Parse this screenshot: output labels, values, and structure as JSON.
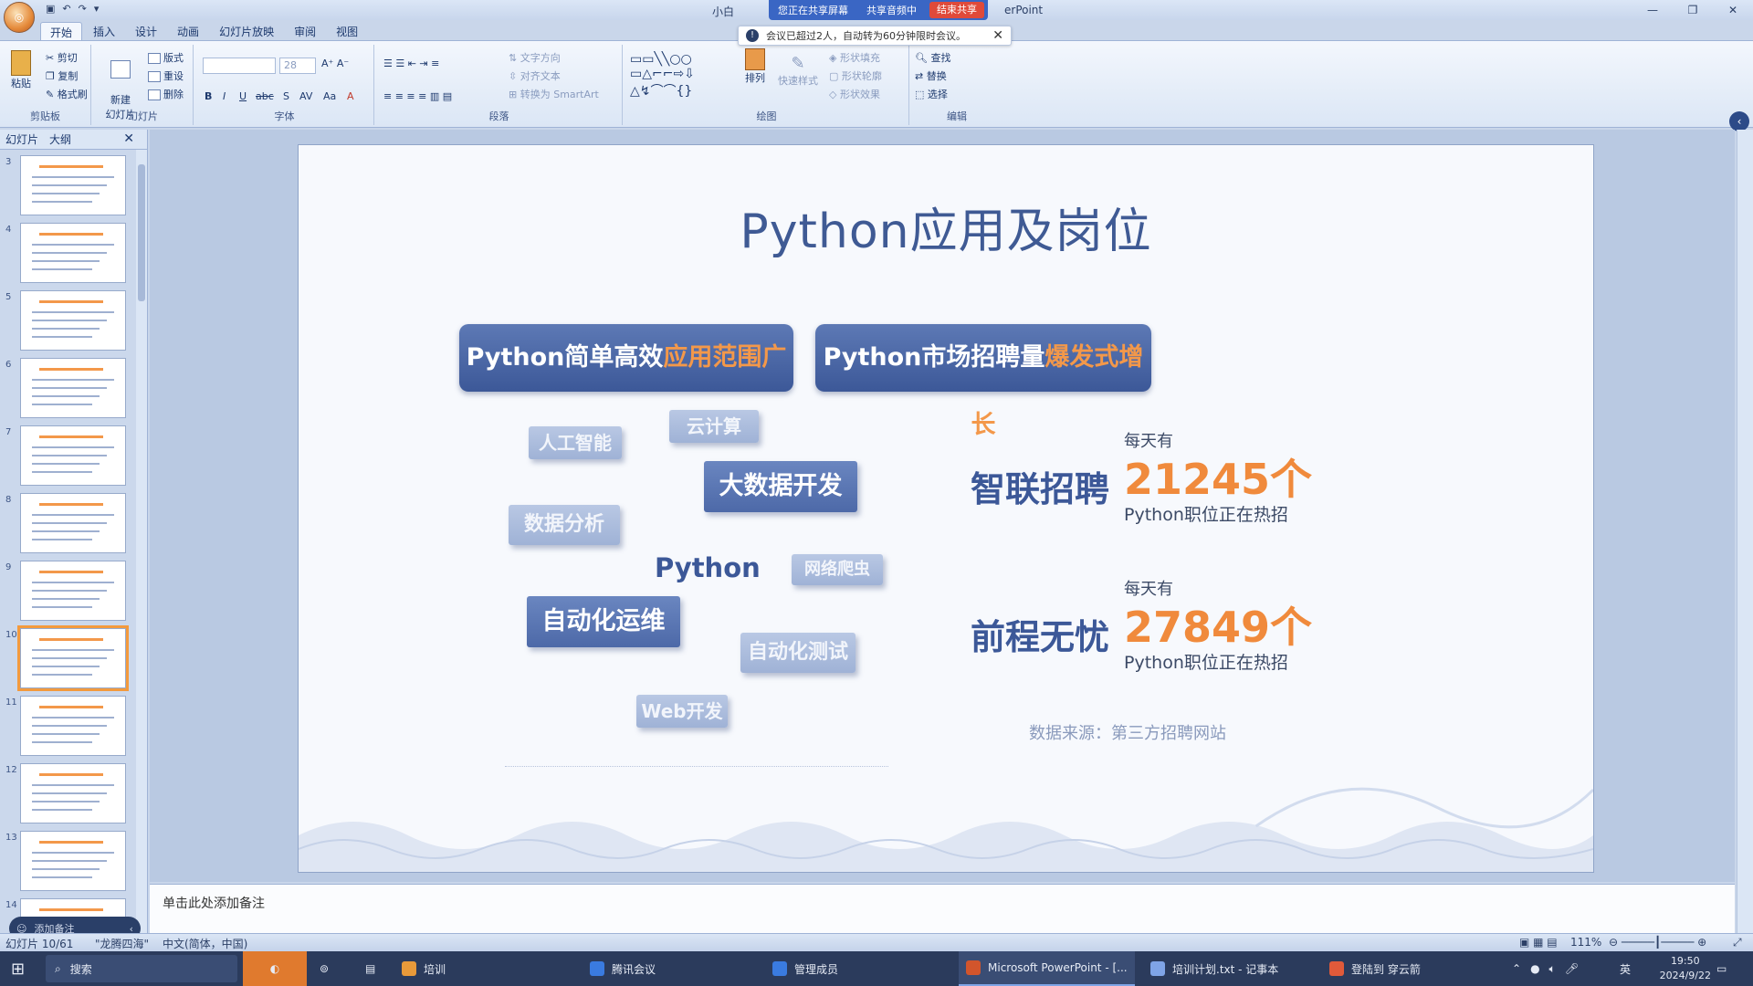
{
  "window": {
    "title_left": "小白",
    "title_right": "erPoint",
    "share": {
      "status": "您正在共享屏幕",
      "audio": "共享音频中",
      "end": "结束共享"
    },
    "controls": [
      "—",
      "❐",
      "✕"
    ]
  },
  "notice": {
    "text": "会议已超过2人，自动转为60分钟限时会议。"
  },
  "ribbon": {
    "tabs": [
      "开始",
      "插入",
      "设计",
      "动画",
      "幻灯片放映",
      "审阅",
      "视图"
    ],
    "active_tab": "开始",
    "groups": {
      "clipboard": {
        "label": "剪贴板",
        "paste": "粘贴",
        "cut": "剪切",
        "copy": "复制",
        "format_painter": "格式刷"
      },
      "slides": {
        "label": "幻灯片",
        "new_slide": "新建\n幻灯片",
        "layout": "版式",
        "reset": "重设",
        "delete": "删除"
      },
      "font": {
        "label": "字体",
        "size": "28",
        "buttons": [
          "B",
          "I",
          "U",
          "abc",
          "S",
          "AV",
          "Aa",
          "A"
        ]
      },
      "paragraph": {
        "label": "段落",
        "text_direction": "文字方向",
        "align_text": "对齐文本",
        "smartart": "转换为 SmartArt"
      },
      "drawing": {
        "label": "绘图",
        "arrange": "排列",
        "quick_styles": "快速样式",
        "fill": "形状填充",
        "outline": "形状轮廓",
        "effects": "形状效果"
      },
      "editing": {
        "label": "编辑",
        "find": "查找",
        "replace": "替换",
        "select": "选择"
      }
    }
  },
  "left_panel": {
    "tabs": [
      "幻灯片",
      "大纲"
    ],
    "slide_numbers": [
      "3",
      "4",
      "5",
      "6",
      "7",
      "8",
      "9",
      "10",
      "11",
      "12",
      "13",
      "14"
    ],
    "selected": "10",
    "mini_toolbar": "添加备注"
  },
  "slide": {
    "title": "Python应用及岗位",
    "left_header": {
      "plain": "Python简单高效",
      "highlight": "应用范围广"
    },
    "right_header": {
      "plain": "Python市场招聘量",
      "highlight": "爆发式增长"
    },
    "center_word": "Python",
    "tags": [
      "云计算",
      "人工智能",
      "大数据开发",
      "数据分析",
      "网络爬虫",
      "自动化运维",
      "自动化测试",
      "Web开发"
    ],
    "stats": [
      {
        "brand": "智联招聘",
        "prefix": "每天有",
        "number": "21245个",
        "sub": "Python职位正在热招"
      },
      {
        "brand": "前程无忧",
        "prefix": "每天有",
        "number": "27849个",
        "sub": "Python职位正在热招"
      }
    ],
    "source": "数据来源：第三方招聘网站"
  },
  "notes": {
    "placeholder": "单击此处添加备注"
  },
  "statusbar": {
    "slide": "幻灯片 10/61",
    "theme": "\"龙腾四海\"",
    "language": "中文(简体，中国)",
    "zoom": "111%"
  },
  "taskbar": {
    "search": "搜索",
    "apps": [
      "培训",
      "腾讯会议",
      "管理成员",
      "Microsoft PowerPoint - [...",
      "培训计划.txt - 记事本",
      "登陆到 穿云箭"
    ],
    "ime": "英",
    "time": "19:50",
    "date": "2024/9/22"
  },
  "colors": {
    "accent": "#3c5898",
    "highlight": "#f08a3c",
    "share": "#3a66c4",
    "end_share": "#e04a3a"
  }
}
